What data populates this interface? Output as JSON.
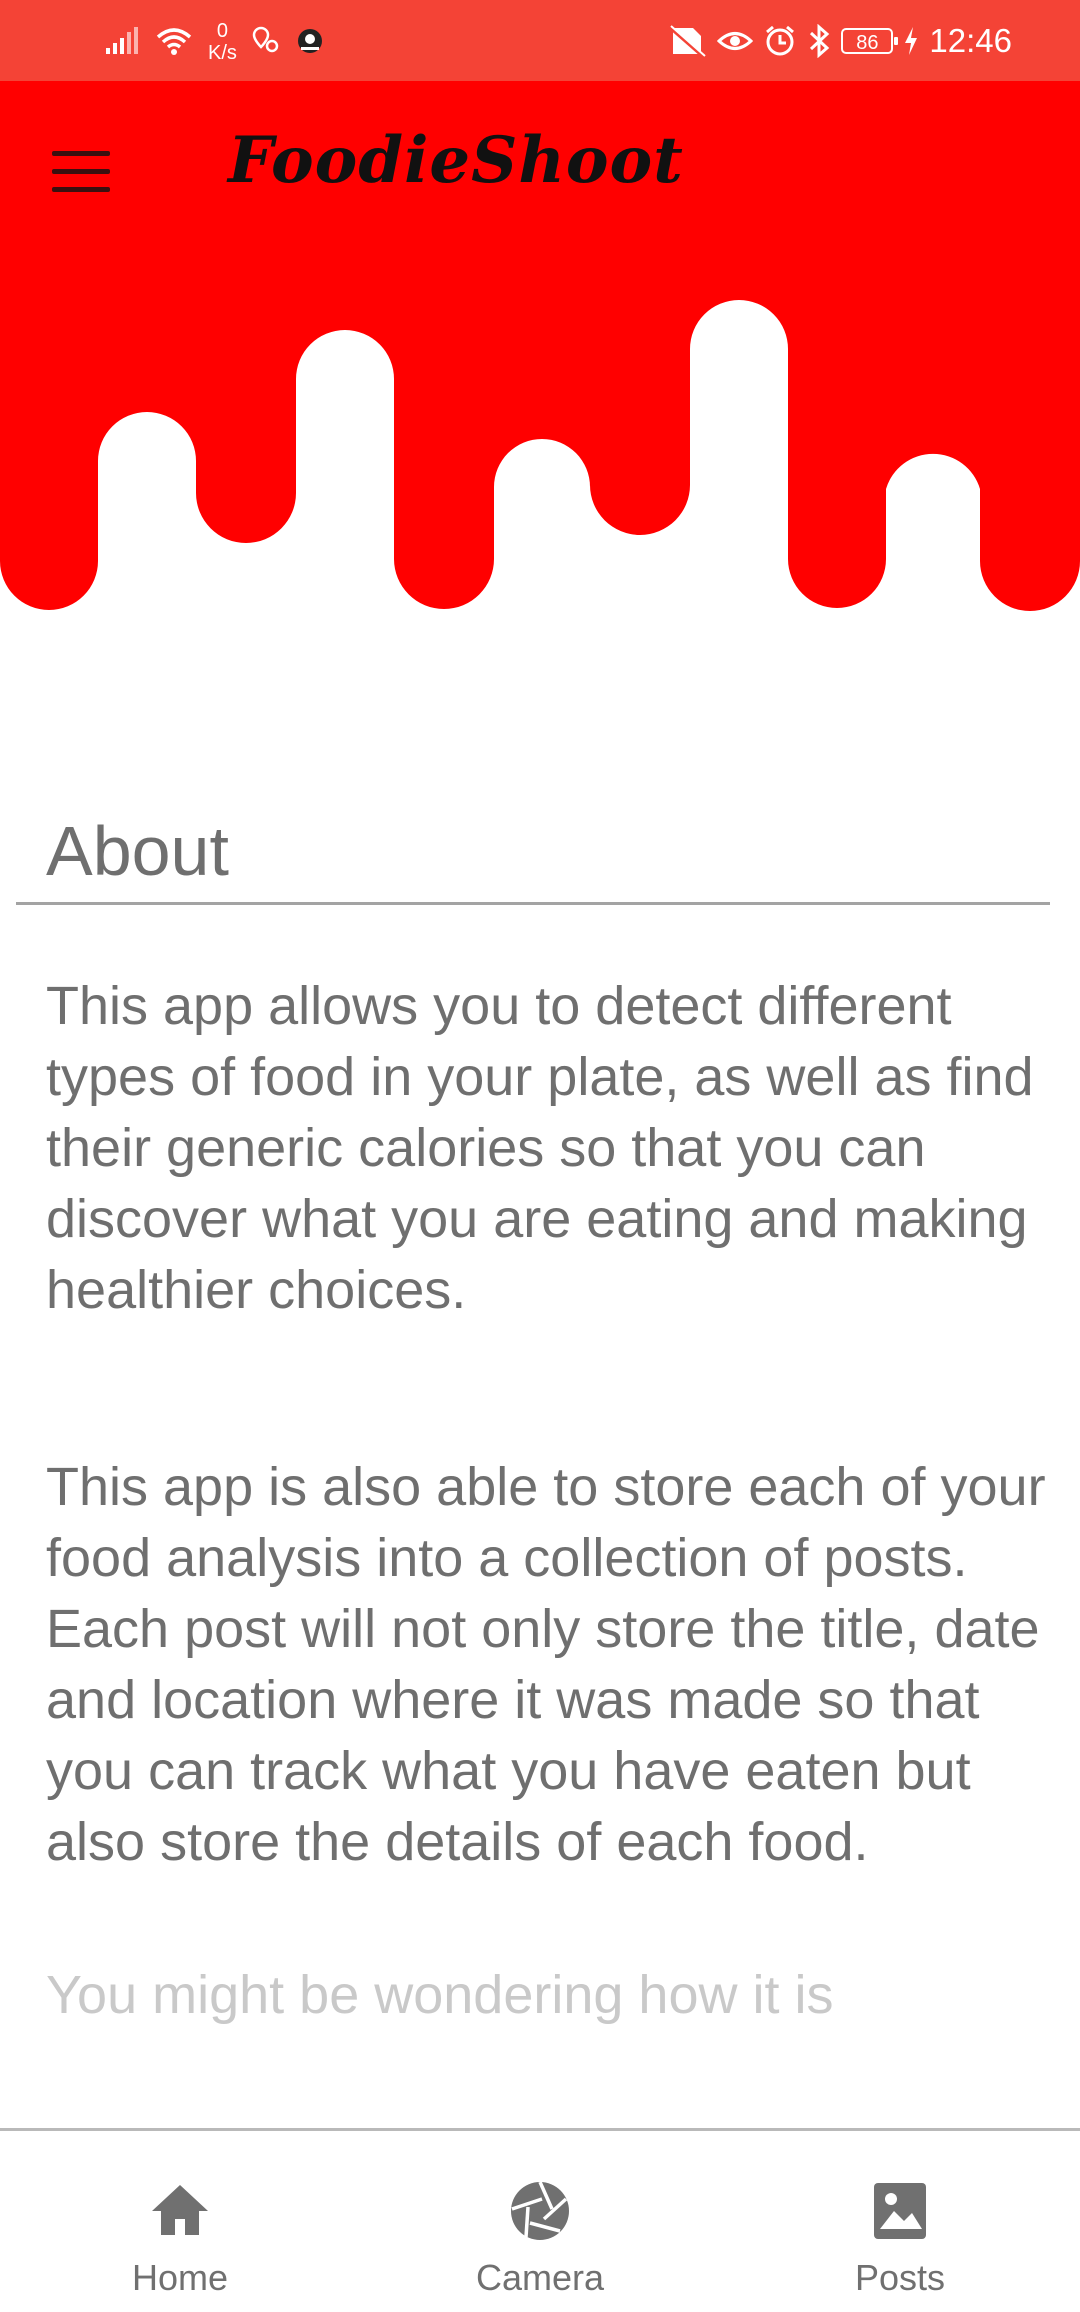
{
  "status_bar": {
    "net_speed_value": "0",
    "net_speed_unit": "K/s",
    "battery": "86",
    "time": "12:46",
    "colors": {
      "background": "#f44336"
    }
  },
  "header": {
    "brand": "FoodieShoot",
    "menu_icon": "hamburger-menu-icon",
    "colors": {
      "drip": "#ff0000"
    }
  },
  "about": {
    "title": "About",
    "paragraphs": [
      "This app allows you to detect different types of food in your plate, as well as find their generic calories so that you can discover what you are eating and making healthier choices.",
      "This app is also able to store each of your food analysis into a collection of posts. Each post will not only store the title, date and location where it was made so that you can track what you have eaten but also store the details of each food.",
      "You might be wondering how it is"
    ]
  },
  "bottom_nav": {
    "items": [
      {
        "label": "Home",
        "icon": "home-icon"
      },
      {
        "label": "Camera",
        "icon": "camera-aperture-icon"
      },
      {
        "label": "Posts",
        "icon": "posts-image-icon"
      }
    ]
  }
}
